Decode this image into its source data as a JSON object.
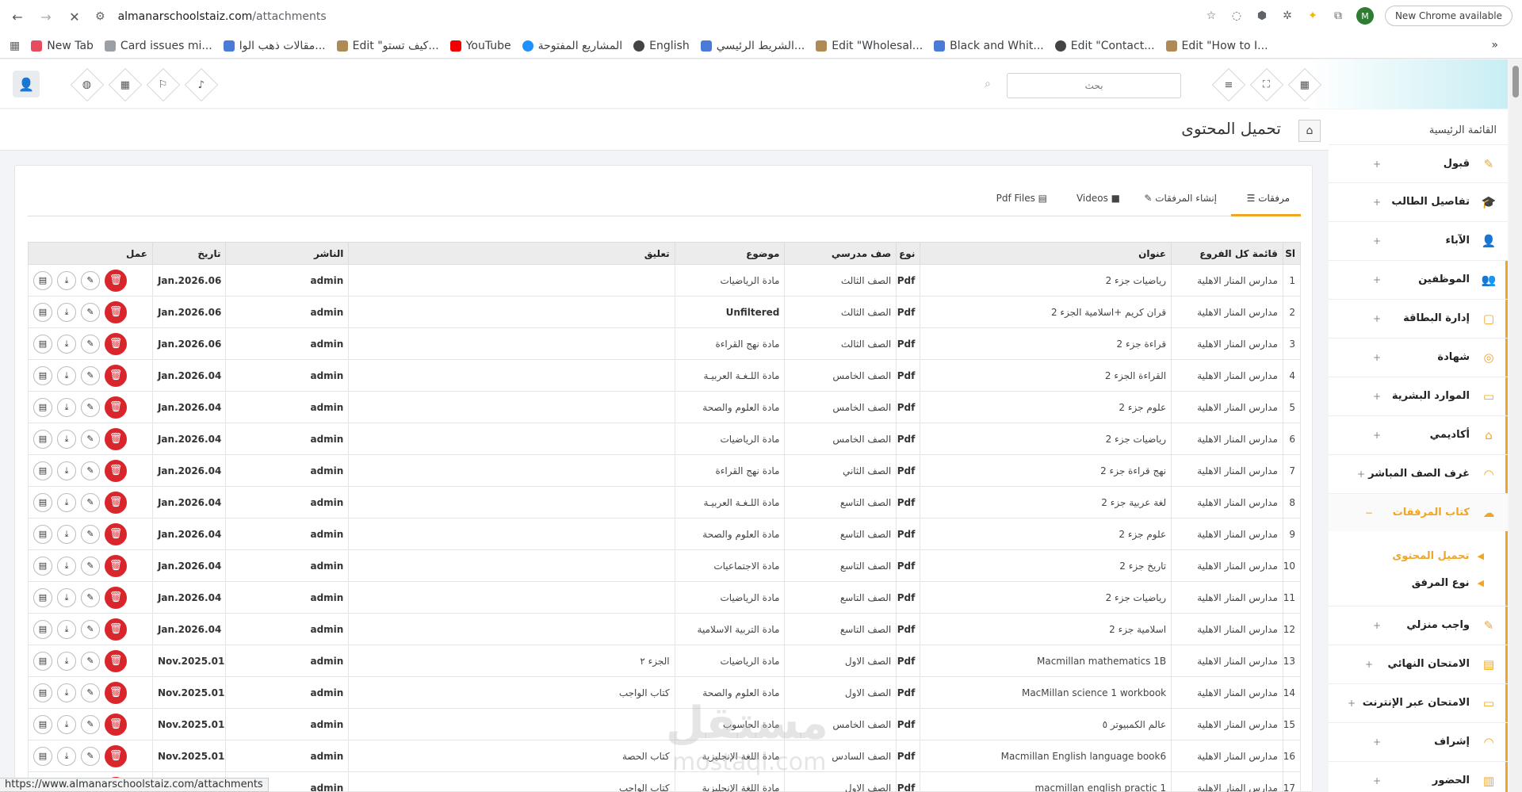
{
  "browser": {
    "url_site": "almanarschoolstaiz.com",
    "url_path": "/attachments",
    "new_chrome": "New Chrome available",
    "profile_initial": "M",
    "status_url": "https://www.almanarschoolstaiz.com/attachments"
  },
  "bookmarks": [
    {
      "label": "New Tab"
    },
    {
      "label": "Card issues mi..."
    },
    {
      "label": "مقالات ذهب الوا..."
    },
    {
      "label": "Edit \"كيف تستو..."
    },
    {
      "label": "YouTube"
    },
    {
      "label": "المشاريع المفتوحة"
    },
    {
      "label": "English"
    },
    {
      "label": "الشريط الرئيسي..."
    },
    {
      "label": "Edit \"Wholesal..."
    },
    {
      "label": "Black and Whit..."
    },
    {
      "label": "Edit \"Contact..."
    },
    {
      "label": "Edit \"How to I..."
    }
  ],
  "header": {
    "search_placeholder": "بحث"
  },
  "page": {
    "title": "تحميل المحتوى"
  },
  "sidebar": {
    "heading": "القائمة الرئيسية",
    "items": [
      {
        "label": "قبول",
        "icon": "✎"
      },
      {
        "label": "تفاصيل الطالب",
        "icon": "🎓"
      },
      {
        "label": "الآباء",
        "icon": "👤"
      },
      {
        "label": "الموظفين",
        "icon": "👥"
      },
      {
        "label": "إدارة البطاقة",
        "icon": "▢"
      },
      {
        "label": "شهادة",
        "icon": "◎"
      },
      {
        "label": "الموارد البشرية",
        "icon": "▭"
      },
      {
        "label": "أكاديمي",
        "icon": "⌂"
      },
      {
        "label": "غرف الصف المباشر",
        "icon": "◠"
      },
      {
        "label": "كتاب المرفقات",
        "icon": "☁"
      }
    ],
    "subitems": [
      {
        "label": "تحميل المحتوى"
      },
      {
        "label": "نوع المرفق"
      }
    ],
    "items2": [
      {
        "label": "واجب منزلي",
        "icon": "✎"
      },
      {
        "label": "الامتحان النهائي",
        "icon": "▤"
      },
      {
        "label": "الامتحان عبر الإنترنت",
        "icon": "▭"
      },
      {
        "label": "إشراف",
        "icon": "◠"
      },
      {
        "label": "الحضور",
        "icon": "▥"
      }
    ]
  },
  "tabs": [
    {
      "label": "مرفقات"
    },
    {
      "label": "إنشاء المرفقات"
    },
    {
      "label": "Videos"
    },
    {
      "label": "Pdf Files"
    }
  ],
  "table": {
    "headers": [
      "Sl",
      "قائمة كل الفروع",
      "عنوان",
      "نوع",
      "صف مدرسي",
      "موضوع",
      "تعليق",
      "الناشر",
      "تاريخ",
      "عمل"
    ],
    "rows": [
      [
        "1",
        "مدارس المنار الاهلية",
        "رياضيات جزء 2",
        "Pdf",
        "الصف الثالث",
        "مادة الرياضيات",
        "",
        "admin",
        "Jan.2026.06"
      ],
      [
        "2",
        "مدارس المنار الاهلية",
        "قران كريم +اسلامية الجزء 2",
        "Pdf",
        "الصف الثالث",
        "Unfiltered",
        "",
        "admin",
        "Jan.2026.06"
      ],
      [
        "3",
        "مدارس المنار الاهلية",
        "قراءة جزء 2",
        "Pdf",
        "الصف الثالث",
        "مادة نهج القراءة",
        "",
        "admin",
        "Jan.2026.06"
      ],
      [
        "4",
        "مدارس المنار الاهلية",
        "القراءة الجزء 2",
        "Pdf",
        "الصف الخامس",
        "مادة اللـغـة العربيـة",
        "",
        "admin",
        "Jan.2026.04"
      ],
      [
        "5",
        "مدارس المنار الاهلية",
        "علوم جزء 2",
        "Pdf",
        "الصف الخامس",
        "مادة العلوم والصحة",
        "",
        "admin",
        "Jan.2026.04"
      ],
      [
        "6",
        "مدارس المنار الاهلية",
        "رياضيات جزء 2",
        "Pdf",
        "الصف الخامس",
        "مادة الرياضيات",
        "",
        "admin",
        "Jan.2026.04"
      ],
      [
        "7",
        "مدارس المنار الاهلية",
        "نهج قراءة جزء 2",
        "Pdf",
        "الصف الثاني",
        "مادة نهج القراءة",
        "",
        "admin",
        "Jan.2026.04"
      ],
      [
        "8",
        "مدارس المنار الاهلية",
        "لغة عربية جزء 2",
        "Pdf",
        "الصف التاسع",
        "مادة اللـغـة العربيـة",
        "",
        "admin",
        "Jan.2026.04"
      ],
      [
        "9",
        "مدارس المنار الاهلية",
        "علوم جزء 2",
        "Pdf",
        "الصف التاسع",
        "مادة العلوم والصحة",
        "",
        "admin",
        "Jan.2026.04"
      ],
      [
        "10",
        "مدارس المنار الاهلية",
        "تاريخ جزء 2",
        "Pdf",
        "الصف التاسع",
        "مادة الاجتماعيات",
        "",
        "admin",
        "Jan.2026.04"
      ],
      [
        "11",
        "مدارس المنار الاهلية",
        "رياضيات جزء 2",
        "Pdf",
        "الصف التاسع",
        "مادة الرياضيات",
        "",
        "admin",
        "Jan.2026.04"
      ],
      [
        "12",
        "مدارس المنار الاهلية",
        "اسلامية جزء 2",
        "Pdf",
        "الصف التاسع",
        "مادة التربية الاسلامية",
        "",
        "admin",
        "Jan.2026.04"
      ],
      [
        "13",
        "مدارس المنار الاهلية",
        "Macmillan mathematics 1B",
        "Pdf",
        "الصف الاول",
        "مادة الرياضيات",
        "الجزء ٢",
        "admin",
        "Nov.2025.01"
      ],
      [
        "14",
        "مدارس المنار الاهلية",
        "MacMillan science 1 workbook",
        "Pdf",
        "الصف الاول",
        "مادة العلوم والصحة",
        "كتاب الواجب",
        "admin",
        "Nov.2025.01"
      ],
      [
        "15",
        "مدارس المنار الاهلية",
        "عالم الكمبيوتر ٥",
        "Pdf",
        "الصف الخامس",
        "مادة الحاسوب",
        "",
        "admin",
        "Nov.2025.01"
      ],
      [
        "16",
        "مدارس المنار الاهلية",
        "Macmillan English language book6",
        "Pdf",
        "الصف السادس",
        "مادة اللغة الإنجليزية",
        "كتاب الحصة",
        "admin",
        "Nov.2025.01"
      ],
      [
        "17",
        "مدارس المنار الاهلية",
        "macmillan english practic 1",
        "Pdf",
        "الصف الاول",
        "مادة اللغة الإنجليزية",
        "كتاب الواجب",
        "admin",
        "Nov.2025.01"
      ]
    ]
  },
  "watermark": {
    "ar": "مستقل",
    "en": "mostaql.com"
  },
  "colors": {
    "accent": "#f0a623",
    "delete": "#d9262c"
  }
}
